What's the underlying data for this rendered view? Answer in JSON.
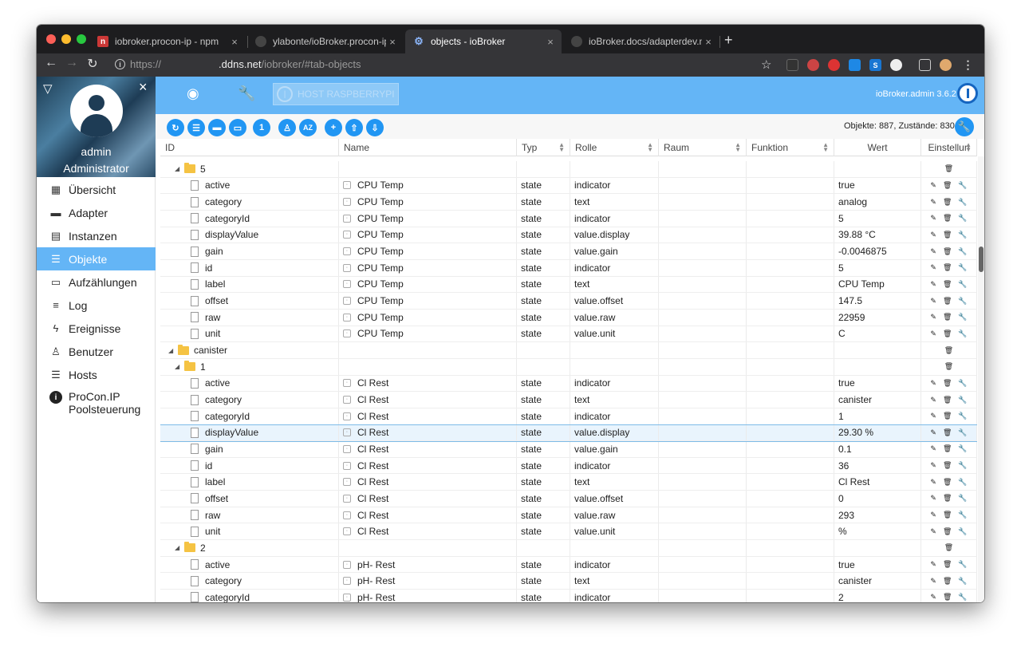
{
  "browser": {
    "tabs": [
      {
        "title": "iobroker.procon-ip - npm",
        "favicon": "npm-icon"
      },
      {
        "title": "ylabonte/ioBroker.procon-ip: A",
        "favicon": "github-icon"
      },
      {
        "title": "objects - ioBroker",
        "favicon": "gear-icon"
      },
      {
        "title": "ioBroker.docs/adapterdev.md",
        "favicon": "github-icon"
      }
    ],
    "close_glyph": "×",
    "new_tab_glyph": "+",
    "url_scheme": "https://",
    "url_host": ".ddns.net",
    "url_path": "/iobroker/#tab-objects"
  },
  "sidebar": {
    "user_name": "admin",
    "user_role": "Administrator",
    "items": [
      {
        "label": "Übersicht",
        "icon": "grid-icon"
      },
      {
        "label": "Adapter",
        "icon": "store-icon"
      },
      {
        "label": "Instanzen",
        "icon": "instances-icon"
      },
      {
        "label": "Objekte",
        "icon": "list-icon",
        "active": true
      },
      {
        "label": "Aufzählungen",
        "icon": "enum-icon"
      },
      {
        "label": "Log",
        "icon": "log-icon"
      },
      {
        "label": "Ereignisse",
        "icon": "flash-icon"
      },
      {
        "label": "Benutzer",
        "icon": "user-icon"
      },
      {
        "label": "Hosts",
        "icon": "hosts-icon"
      },
      {
        "label": "ProCon.IP Poolsteuerung",
        "label_line1": "ProCon.IP",
        "label_line2": "Poolsteuerung",
        "icon": "info-icon"
      }
    ]
  },
  "header": {
    "host_label": "HOST RASPBERRYPI",
    "version": "ioBroker.admin 3.6.2"
  },
  "toolbar": {
    "count_text": "Objekte: 887, Zustände: 830",
    "buttons": [
      "refresh-icon",
      "list-icon",
      "folder-filled-icon",
      "folder-open-icon",
      "one-icon",
      "person-icon",
      "az-icon",
      "add-icon",
      "upload-icon",
      "download-icon"
    ],
    "az_label": "AZ",
    "one_label": "1"
  },
  "table": {
    "columns": [
      "ID",
      "Name",
      "Typ",
      "Rolle",
      "Raum",
      "Funktion",
      "Wert",
      "Einstellun"
    ],
    "rows": [
      {
        "kind": "folder",
        "level": 1,
        "id": "5"
      },
      {
        "kind": "state",
        "id": "active",
        "name": "CPU Temp",
        "typ": "state",
        "rolle": "indicator",
        "wert": "true"
      },
      {
        "kind": "state",
        "id": "category",
        "name": "CPU Temp",
        "typ": "state",
        "rolle": "text",
        "wert": "analog"
      },
      {
        "kind": "state",
        "id": "categoryId",
        "name": "CPU Temp",
        "typ": "state",
        "rolle": "indicator",
        "wert": "5"
      },
      {
        "kind": "state",
        "id": "displayValue",
        "name": "CPU Temp",
        "typ": "state",
        "rolle": "value.display",
        "wert": "39.88 °C"
      },
      {
        "kind": "state",
        "id": "gain",
        "name": "CPU Temp",
        "typ": "state",
        "rolle": "value.gain",
        "wert": "-0.0046875"
      },
      {
        "kind": "state",
        "id": "id",
        "name": "CPU Temp",
        "typ": "state",
        "rolle": "indicator",
        "wert": "5"
      },
      {
        "kind": "state",
        "id": "label",
        "name": "CPU Temp",
        "typ": "state",
        "rolle": "text",
        "wert": "CPU Temp"
      },
      {
        "kind": "state",
        "id": "offset",
        "name": "CPU Temp",
        "typ": "state",
        "rolle": "value.offset",
        "wert": "147.5"
      },
      {
        "kind": "state",
        "id": "raw",
        "name": "CPU Temp",
        "typ": "state",
        "rolle": "value.raw",
        "wert": "22959"
      },
      {
        "kind": "state",
        "id": "unit",
        "name": "CPU Temp",
        "typ": "state",
        "rolle": "value.unit",
        "wert": "C"
      },
      {
        "kind": "folder",
        "level": 0,
        "id": "canister"
      },
      {
        "kind": "folder",
        "level": 1,
        "id": "1"
      },
      {
        "kind": "state",
        "id": "active",
        "name": "Cl Rest",
        "typ": "state",
        "rolle": "indicator",
        "wert": "true"
      },
      {
        "kind": "state",
        "id": "category",
        "name": "Cl Rest",
        "typ": "state",
        "rolle": "text",
        "wert": "canister"
      },
      {
        "kind": "state",
        "id": "categoryId",
        "name": "Cl Rest",
        "typ": "state",
        "rolle": "indicator",
        "wert": "1"
      },
      {
        "kind": "state",
        "id": "displayValue",
        "name": "Cl Rest",
        "typ": "state",
        "rolle": "value.display",
        "wert": "29.30 %",
        "selected": true
      },
      {
        "kind": "state",
        "id": "gain",
        "name": "Cl Rest",
        "typ": "state",
        "rolle": "value.gain",
        "wert": "0.1"
      },
      {
        "kind": "state",
        "id": "id",
        "name": "Cl Rest",
        "typ": "state",
        "rolle": "indicator",
        "wert": "36"
      },
      {
        "kind": "state",
        "id": "label",
        "name": "Cl Rest",
        "typ": "state",
        "rolle": "text",
        "wert": "Cl Rest"
      },
      {
        "kind": "state",
        "id": "offset",
        "name": "Cl Rest",
        "typ": "state",
        "rolle": "value.offset",
        "wert": "0"
      },
      {
        "kind": "state",
        "id": "raw",
        "name": "Cl Rest",
        "typ": "state",
        "rolle": "value.raw",
        "wert": "293"
      },
      {
        "kind": "state",
        "id": "unit",
        "name": "Cl Rest",
        "typ": "state",
        "rolle": "value.unit",
        "wert": "%"
      },
      {
        "kind": "folder",
        "level": 1,
        "id": "2"
      },
      {
        "kind": "state",
        "id": "active",
        "name": "pH- Rest",
        "typ": "state",
        "rolle": "indicator",
        "wert": "true"
      },
      {
        "kind": "state",
        "id": "category",
        "name": "pH- Rest",
        "typ": "state",
        "rolle": "text",
        "wert": "canister"
      },
      {
        "kind": "state",
        "id": "categoryId",
        "name": "pH- Rest",
        "typ": "state",
        "rolle": "indicator",
        "wert": "2"
      }
    ]
  },
  "colors": {
    "accent": "#64b5f6",
    "button_blue": "#2196f3",
    "folder": "#f5c343"
  }
}
